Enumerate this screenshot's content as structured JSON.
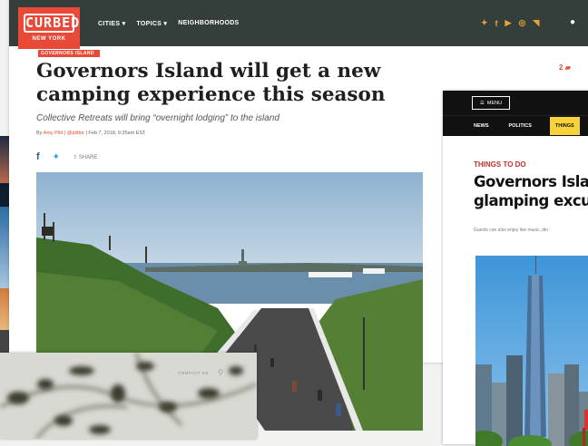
{
  "curbed": {
    "logo": {
      "brand": "CURBED",
      "city": "NEW YORK"
    },
    "nav": [
      "CITIES",
      "TOPICS",
      "NEIGHBORHOODS"
    ],
    "social_icons": [
      "twitter-icon",
      "facebook-icon",
      "youtube-icon",
      "instagram-icon",
      "rss-icon"
    ],
    "tag": "GOVERNORS ISLAND",
    "comment_count": "2",
    "headline": "Governors Island will get a new camping experience this season",
    "subhead": "Collective Retreats will bring “overnight lodging” to the island",
    "byline": {
      "prefix": "By",
      "author": "Amy Plitt",
      "handle": "@plittor",
      "date": "Feb 7, 2018, 9:35am EST"
    },
    "share_label": "SHARE"
  },
  "third_site": {
    "menu_label": "MENU",
    "tabs": [
      "NEWS",
      "POLITICS",
      "THINGS"
    ],
    "kicker": "THINGS TO DO",
    "headline": "Governors Islan\nglamping excur",
    "description": "Guests can also enjoy live music, din"
  },
  "blurred_site": {
    "nav_label": "CONTACT US"
  }
}
